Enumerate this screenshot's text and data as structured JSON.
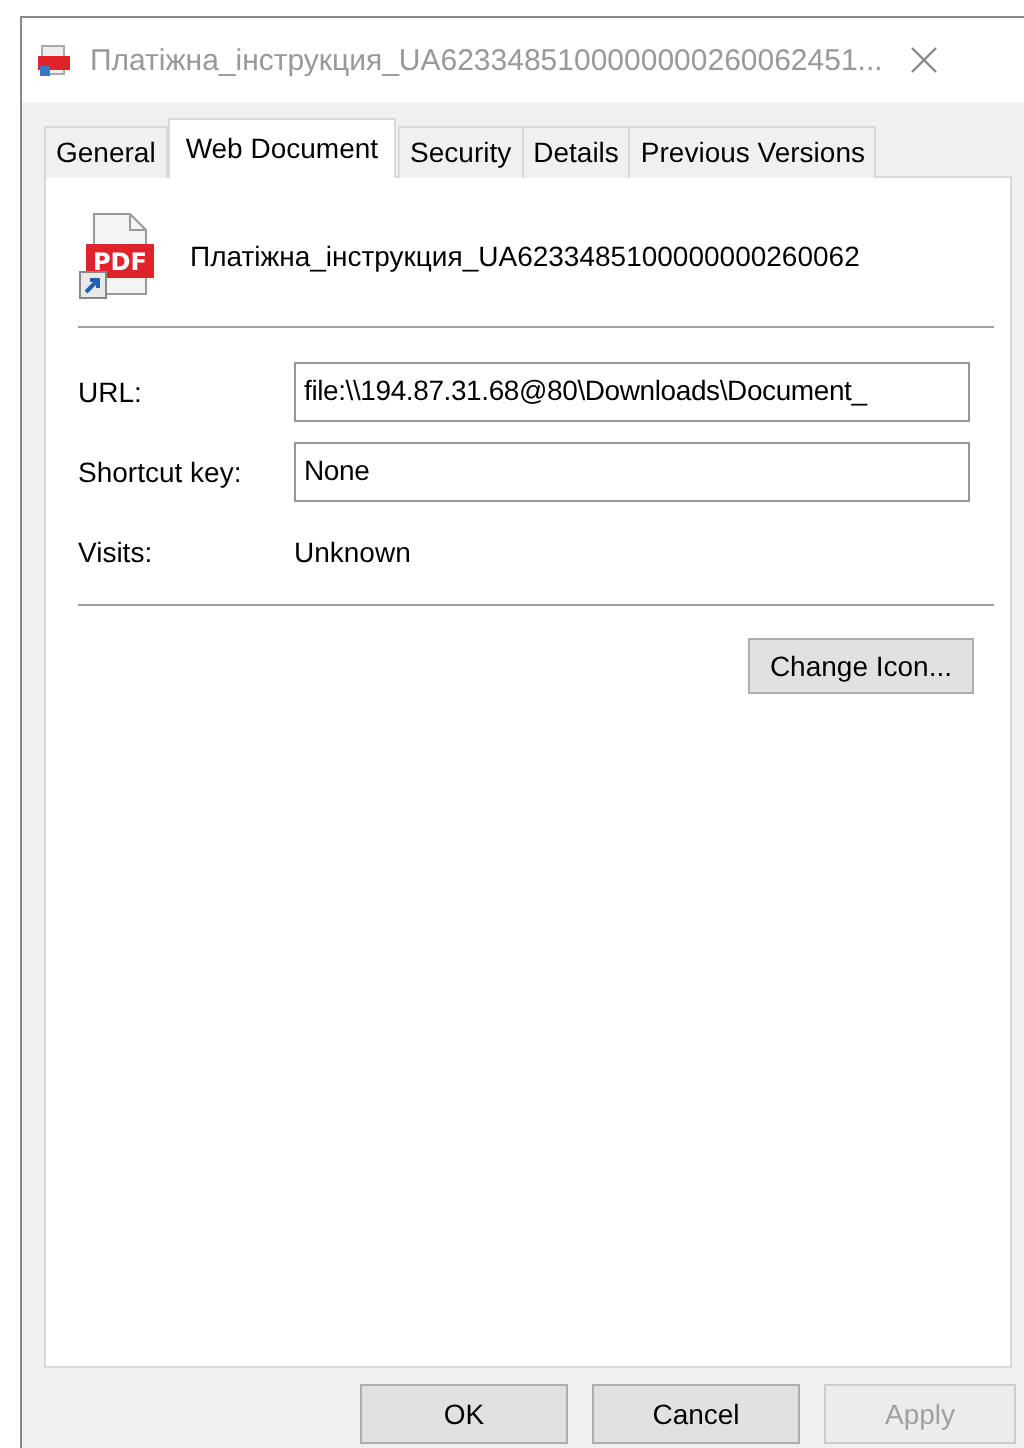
{
  "window": {
    "title": "Платіжна_інструкция_UA6233485100000000260062451..."
  },
  "tabs": [
    {
      "label": "General",
      "selected": false
    },
    {
      "label": "Web Document",
      "selected": true
    },
    {
      "label": "Security",
      "selected": false
    },
    {
      "label": "Details",
      "selected": false
    },
    {
      "label": "Previous Versions",
      "selected": false
    }
  ],
  "file_icon_label": "PDF",
  "file_name": "Платіжна_інструкция_UA6233485100000000260062",
  "fields": [
    {
      "kind": "input",
      "label": "URL:",
      "value": "file:\\\\194.87.31.68@80\\Downloads\\Document_"
    },
    {
      "kind": "input",
      "label": "Shortcut key:",
      "value": "None"
    },
    {
      "kind": "text",
      "label": "Visits:",
      "value": "Unknown"
    }
  ],
  "change_icon_button": "Change Icon...",
  "buttons": [
    {
      "label": "OK",
      "disabled": false
    },
    {
      "label": "Cancel",
      "disabled": false
    },
    {
      "label": "Apply",
      "disabled": true
    }
  ]
}
